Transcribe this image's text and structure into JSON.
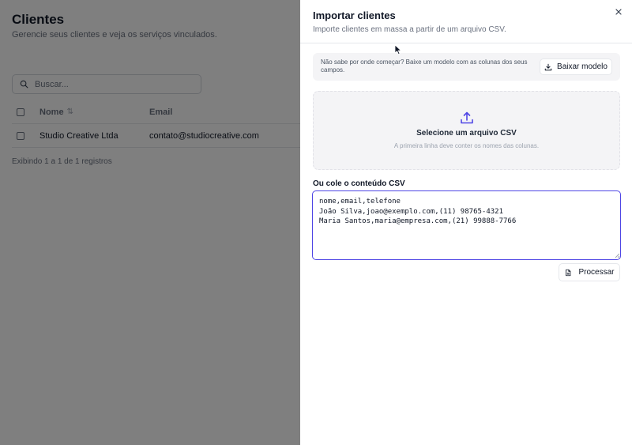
{
  "page": {
    "title": "Clientes",
    "subtitle": "Gerencie seus clientes e veja os serviços vinculados.",
    "search_placeholder": "Buscar...",
    "table": {
      "columns": {
        "name": "Nome",
        "email": "Email"
      },
      "rows": [
        {
          "name": "Studio Creative Ltda",
          "email": "contato@studiocreative.com"
        }
      ]
    },
    "records_info": "Exibindo 1 a 1 de 1 registros"
  },
  "drawer": {
    "title": "Importar clientes",
    "subtitle": "Importe clientes em massa a partir de um arquivo CSV.",
    "hint": "Não sabe por onde começar? Baixe um modelo com as colunas dos seus campos.",
    "download_label": "Baixar modelo",
    "dropzone_title": "Selecione um arquivo CSV",
    "dropzone_subtitle": "A primeira linha deve conter os nomes das colunas.",
    "paste_label": "Ou cole o conteúdo CSV",
    "csv_content": "nome,email,telefone\nJoão Silva,joao@exemplo.com,(11) 98765-4321\nMaria Santos,maria@empresa.com,(21) 99888-7766",
    "process_label": "Processar"
  },
  "colors": {
    "accent": "#4f46e5",
    "overlay": "rgba(0,0,0,0.5)"
  }
}
